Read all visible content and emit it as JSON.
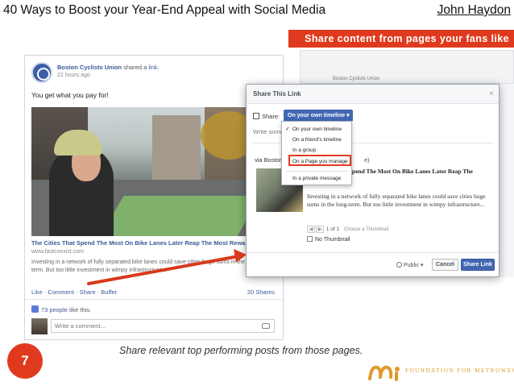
{
  "slide": {
    "title": "40 Ways to Boost your Year-End Appeal with Social Media",
    "author": "John Haydon",
    "banner": "Share content from pages your fans like",
    "caption": "Share relevant top performing posts from those pages.",
    "page_number": "7",
    "logo_text": "FOUNDATION FOR METROWEST",
    "accent_color": "#e03a1e"
  },
  "post": {
    "page_name": "Boston Cyclists Union",
    "shared_text": "shared a",
    "shared_link": "link.",
    "time": "22 hours ago",
    "message": "You get what you pay for!",
    "link_title": "The Cities That Spend The Most On Bike Lanes Later Reap The Most Rewa",
    "link_url": "www.fastcoexist.com",
    "link_desc": "Investing in a network of fully separated bike lanes could save cities huge sums in the long-term. But too little investment in wimpy infrastructure...",
    "actions": "Like · Comment · Share · Buffer",
    "shares": "20 Shares",
    "likes_count": "73 people",
    "likes_suffix": "like this.",
    "comment_placeholder": "Write a comment..."
  },
  "dialog": {
    "title": "Share This Link",
    "close": "×",
    "share_label": "Share:",
    "dropdown_value": "On your own timeline ▾",
    "write_placeholder": "Write something...",
    "via": "via Boston Cyclists Union",
    "via_paren": "e)",
    "link_title": "The Cities That Spend The Most On Bike Lanes Later Reap The Most Rewards",
    "link_desc": "Investing in a network of fully separated bike lanes could save cities huge sums in the long-term. But too little investment in wimpy infrastructure...",
    "pager_count": "1 of 1",
    "pager_hint": "Choose a Thumbnail",
    "no_thumbnail": "No Thumbnail",
    "privacy": "Public ▾",
    "cancel": "Cancel",
    "share_button": "Share Link",
    "background_text": "Boston Cyclists Union"
  },
  "menu": {
    "items": [
      "On your own timeline",
      "On a friend's timeline",
      "In a group",
      "On a Page you manage",
      "In a private message"
    ],
    "selected": "On your own timeline",
    "highlighted": "On a Page you manage"
  }
}
